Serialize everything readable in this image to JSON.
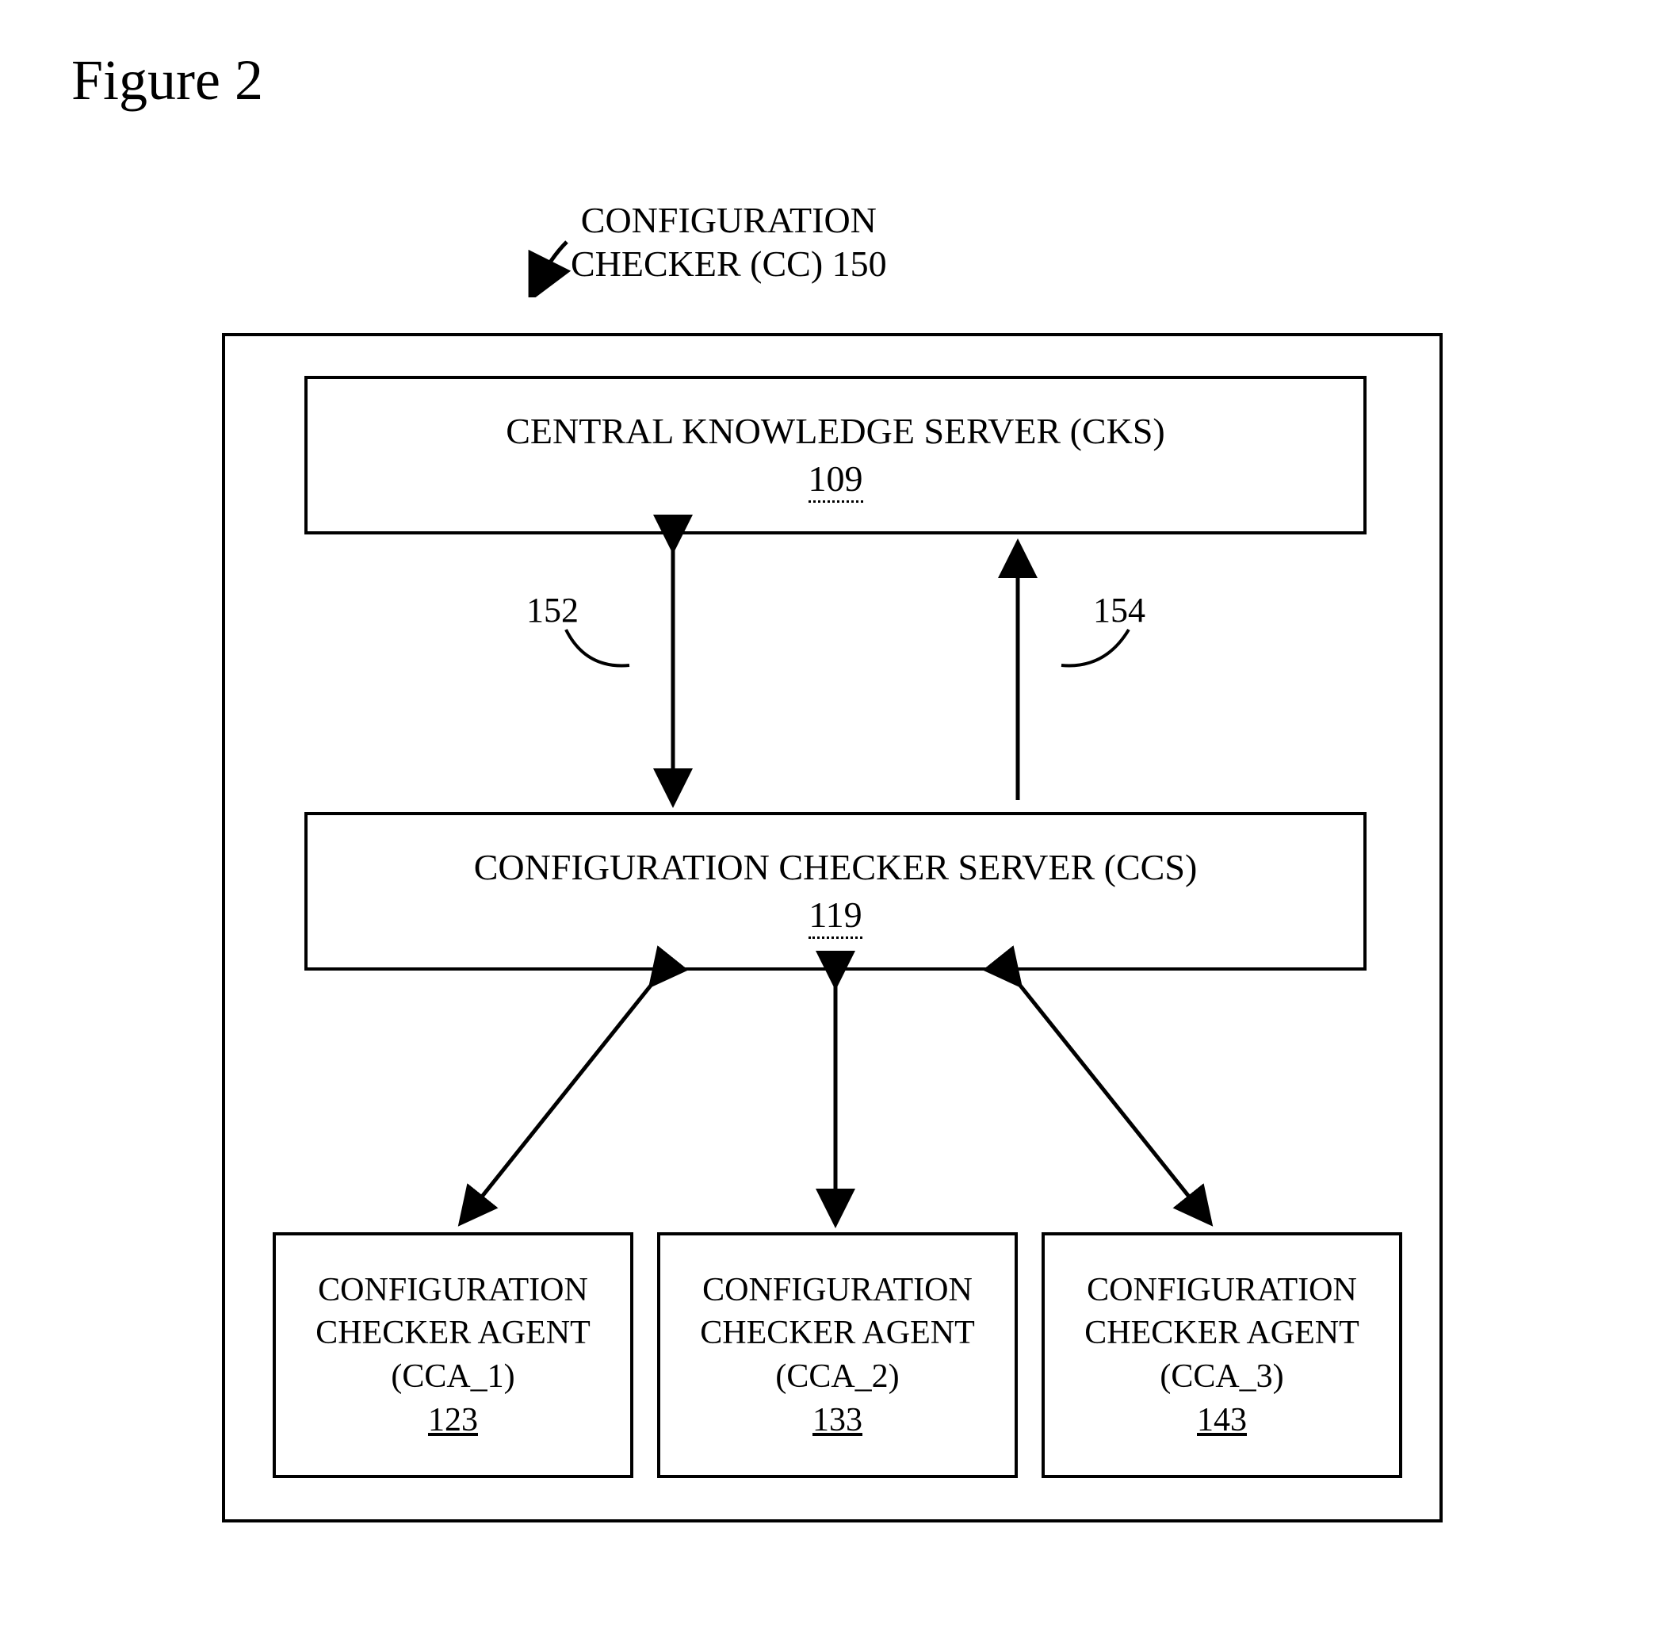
{
  "figure_label": "Figure 2",
  "title": {
    "line1": "CONFIGURATION",
    "line2": "CHECKER (CC) 150"
  },
  "blocks": {
    "cks": {
      "label": "CENTRAL KNOWLEDGE SERVER (CKS)",
      "ref": "109"
    },
    "ccs": {
      "label": "CONFIGURATION CHECKER SERVER (CCS)",
      "ref": "119"
    },
    "agent1": {
      "line1": "CONFIGURATION",
      "line2": "CHECKER AGENT",
      "line3": "(CCA_1)",
      "ref": "123"
    },
    "agent2": {
      "line1": "CONFIGURATION",
      "line2": "CHECKER AGENT",
      "line3": "(CCA_2)",
      "ref": "133"
    },
    "agent3": {
      "line1": "CONFIGURATION",
      "line2": "CHECKER AGENT",
      "line3": "(CCA_3)",
      "ref": "143"
    }
  },
  "arrows": {
    "left_label": "152",
    "right_label": "154"
  }
}
